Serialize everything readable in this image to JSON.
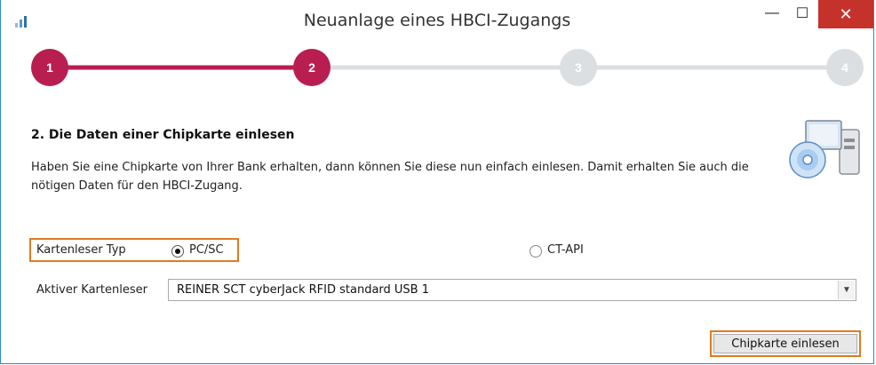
{
  "window": {
    "title": "Neuanlage eines HBCI-Zugangs",
    "app_icon": "signal-bars-icon",
    "controls": {
      "minimize": "—",
      "maximize": "☐",
      "close": "✕"
    }
  },
  "progress": {
    "steps": [
      "1",
      "2",
      "3",
      "4"
    ],
    "current_step": 2,
    "active_color": "#b81e50",
    "inactive_color": "#dcdfe2"
  },
  "section": {
    "heading": "2. Die Daten einer Chipkarte einlesen",
    "description": "Haben Sie eine Chipkarte von Ihrer Bank erhalten, dann können Sie diese nun einfach einlesen. Damit erhalten Sie auch die nötigen Daten für den HBCI-Zugang.",
    "icon": "chipcard-reader-computer-icon"
  },
  "reader_type": {
    "label": "Kartenleser Typ",
    "options": [
      {
        "label": "PC/SC",
        "selected": true
      },
      {
        "label": "CT-API",
        "selected": false
      }
    ]
  },
  "active_reader": {
    "label": "Aktiver Kartenleser",
    "value": "REINER SCT cyberJack RFID standard USB 1"
  },
  "actions": {
    "read_card": "Chipkarte einlesen"
  },
  "colors": {
    "highlight": "#e07a1f",
    "close_button": "#c5322c",
    "window_border": "#2a8ad4"
  }
}
